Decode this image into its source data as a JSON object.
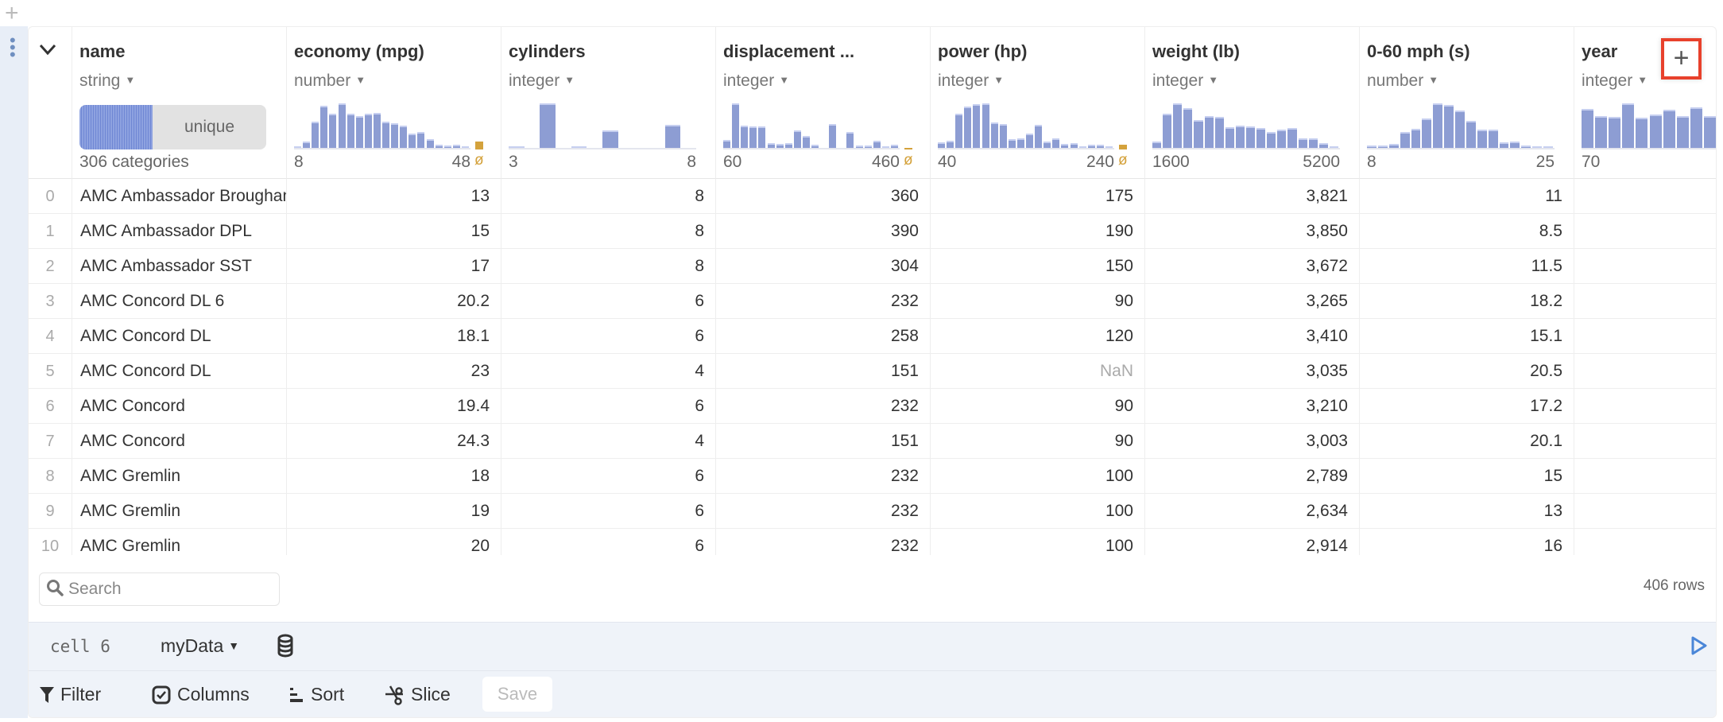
{
  "toolbar_top": {
    "add_icon": "plus-icon"
  },
  "columns": [
    {
      "title": "name",
      "type": "string",
      "summary": "unique",
      "footer": "306 categories"
    },
    {
      "title": "economy (mpg)",
      "type": "number",
      "min": "8",
      "max": "48",
      "has_null": true,
      "hist": [
        5,
        23,
        96,
        152,
        123,
        162,
        123,
        115,
        123,
        127,
        96,
        89,
        81,
        52,
        57,
        31,
        12,
        8,
        12,
        6
      ],
      "null_count": 30
    },
    {
      "title": "cylinders",
      "type": "integer",
      "min": "3",
      "max": "8",
      "has_null": false,
      "hist": [
        4,
        162,
        4,
        65,
        0,
        85
      ],
      "gapped": true
    },
    {
      "title": "displacement ...",
      "type": "integer",
      "min": "60",
      "max": "460",
      "has_null": true,
      "hist": [
        30,
        162,
        81,
        79,
        79,
        18,
        14,
        16,
        64,
        44,
        12,
        0,
        86,
        0,
        58,
        10,
        8,
        26,
        6,
        12
      ],
      "null_count": 2
    },
    {
      "title": "power (hp)",
      "type": "integer",
      "min": "40",
      "max": "240",
      "has_null": true,
      "hist": [
        20,
        27,
        125,
        150,
        159,
        162,
        93,
        87,
        31,
        35,
        51,
        83,
        23,
        35,
        15,
        17,
        7,
        12,
        12,
        6
      ],
      "null_count": 17
    },
    {
      "title": "weight (lb)",
      "type": "integer",
      "min": "1600",
      "max": "5200",
      "has_null": false,
      "hist": [
        24,
        125,
        162,
        145,
        102,
        115,
        112,
        74,
        81,
        78,
        71,
        57,
        68,
        71,
        34,
        34,
        17,
        6
      ]
    },
    {
      "title": "0-60 mph (s)",
      "type": "number",
      "min": "8",
      "max": "25",
      "has_null": false,
      "hist": [
        10,
        8,
        15,
        58,
        70,
        107,
        162,
        155,
        137,
        97,
        68,
        68,
        20,
        23,
        8,
        6,
        6
      ]
    },
    {
      "title": "year",
      "type": "integer",
      "min": "70",
      "max": "",
      "has_null": false,
      "hist": [
        142,
        117,
        114,
        162,
        110,
        122,
        139,
        115,
        147,
        117
      ]
    }
  ],
  "rows": [
    [
      "0",
      "AMC Ambassador Brougham",
      "13",
      "8",
      "360",
      "175",
      "3,821",
      "11"
    ],
    [
      "1",
      "AMC Ambassador DPL",
      "15",
      "8",
      "390",
      "190",
      "3,850",
      "8.5"
    ],
    [
      "2",
      "AMC Ambassador SST",
      "17",
      "8",
      "304",
      "150",
      "3,672",
      "11.5"
    ],
    [
      "3",
      "AMC Concord DL 6",
      "20.2",
      "6",
      "232",
      "90",
      "3,265",
      "18.2"
    ],
    [
      "4",
      "AMC Concord DL",
      "18.1",
      "6",
      "258",
      "120",
      "3,410",
      "15.1"
    ],
    [
      "5",
      "AMC Concord DL",
      "23",
      "4",
      "151",
      "NaN",
      "3,035",
      "20.5"
    ],
    [
      "6",
      "AMC Concord",
      "19.4",
      "6",
      "232",
      "90",
      "3,210",
      "17.2"
    ],
    [
      "7",
      "AMC Concord",
      "24.3",
      "4",
      "151",
      "90",
      "3,003",
      "20.1"
    ],
    [
      "8",
      "AMC Gremlin",
      "18",
      "6",
      "232",
      "100",
      "2,789",
      "15"
    ],
    [
      "9",
      "AMC Gremlin",
      "19",
      "6",
      "232",
      "100",
      "2,634",
      "13"
    ],
    [
      "10",
      "AMC Gremlin",
      "20",
      "6",
      "232",
      "100",
      "2,914",
      "16"
    ]
  ],
  "search": {
    "placeholder": "Search"
  },
  "row_count": "406 rows",
  "cell": {
    "label": "cell 6",
    "dataset": "myData"
  },
  "actions": {
    "filter": "Filter",
    "columns": "Columns",
    "sort": "Sort",
    "slice": "Slice",
    "save": "Save"
  },
  "add_column": "+",
  "colors": {
    "bar": "#8d9dd3",
    "null": "#d4a23c",
    "highlight": "#e8412c"
  }
}
